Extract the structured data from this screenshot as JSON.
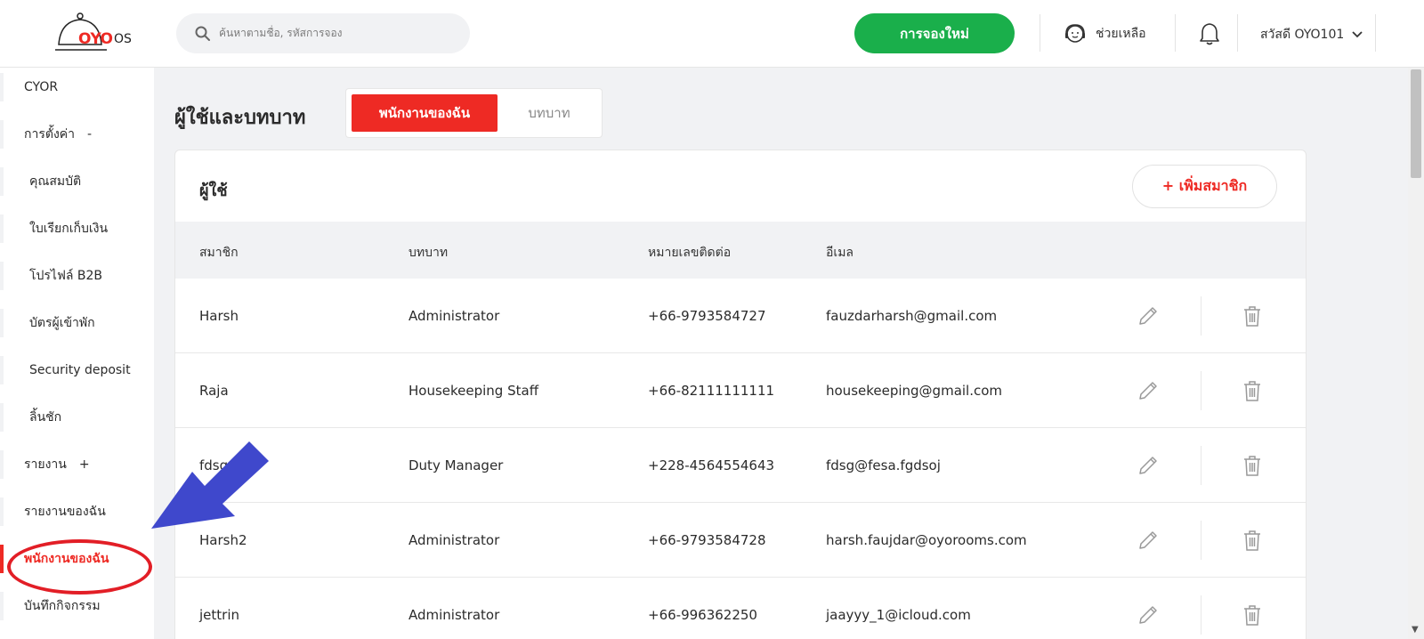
{
  "header": {
    "logo_word": "OYO",
    "logo_suffix": "OS",
    "search_placeholder": "ค้นหาตามชื่อ, รหัสการจอง",
    "new_booking": "การจองใหม่",
    "help": "ช่วยเหลือ",
    "greeting": "สวัสดี OYO101"
  },
  "sidebar": {
    "items": [
      {
        "label": "CYOR",
        "sign": ""
      },
      {
        "label": "การตั้งค่า",
        "sign": "-"
      },
      {
        "label": "คุณสมบัติ",
        "sign": ""
      },
      {
        "label": "ใบเรียกเก็บเงิน",
        "sign": ""
      },
      {
        "label": "โปรไฟล์ B2B",
        "sign": ""
      },
      {
        "label": "บัตรผู้เข้าพัก",
        "sign": ""
      },
      {
        "label": "Security deposit",
        "sign": ""
      },
      {
        "label": "ลิ้นชัก",
        "sign": ""
      },
      {
        "label": "รายงาน",
        "sign": "+"
      },
      {
        "label": "รายงานของฉัน",
        "sign": ""
      },
      {
        "label": "พนักงานของฉัน",
        "sign": ""
      },
      {
        "label": "บันทึกกิจกรรม",
        "sign": ""
      }
    ]
  },
  "main": {
    "title": "ผู้ใช้และบทบาท",
    "tabs": [
      "พนักงานของฉัน",
      "บทบาท"
    ],
    "card_title": "ผู้ใช้",
    "add_member": "+  เพิ่มสมาชิก",
    "columns": [
      "สมาชิก",
      "บทบาท",
      "หมายเลขติดต่อ",
      "อีเมล"
    ],
    "rows": [
      {
        "name": "Harsh",
        "role": "Administrator",
        "phone": "+66-9793584727",
        "email": "fauzdarharsh@gmail.com"
      },
      {
        "name": "Raja",
        "role": "Housekeeping Staff",
        "phone": "+66-82111111111",
        "email": "housekeeping@gmail.com"
      },
      {
        "name": "fdsg",
        "role": "Duty Manager",
        "phone": "+228-4564554643",
        "email": "fdsg@fesa.fgdsoj"
      },
      {
        "name": "Harsh2",
        "role": "Administrator",
        "phone": "+66-9793584728",
        "email": "harsh.faujdar@oyorooms.com"
      },
      {
        "name": "jettrin",
        "role": "Administrator",
        "phone": "+66-996362250",
        "email": "jaayyy_1@icloud.com"
      }
    ]
  },
  "colors": {
    "brand_red": "#ee2a24",
    "cta_green": "#1aaf4b",
    "annotation_blue": "#3f48cc"
  }
}
